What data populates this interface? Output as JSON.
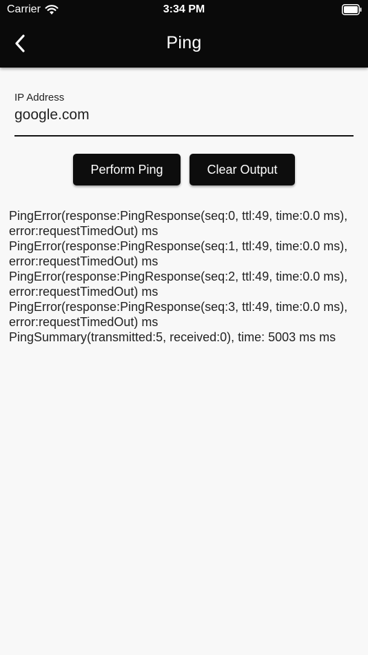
{
  "status_bar": {
    "carrier": "Carrier",
    "time": "3:34 PM",
    "icons": [
      "wifi-icon",
      "battery-icon"
    ]
  },
  "header": {
    "title": "Ping",
    "back_icon": "chevron-left-icon"
  },
  "form": {
    "ip_label": "IP Address",
    "ip_value": "google.com"
  },
  "buttons": {
    "perform_ping": "Perform Ping",
    "clear_output": "Clear Output"
  },
  "output": {
    "lines": [
      "PingError(response:PingResponse(seq:0, ttl:49, time:0.0 ms), error:requestTimedOut) ms",
      "PingError(response:PingResponse(seq:1, ttl:49, time:0.0 ms), error:requestTimedOut) ms",
      "PingError(response:PingResponse(seq:2, ttl:49, time:0.0 ms), error:requestTimedOut) ms",
      "PingError(response:PingResponse(seq:3, ttl:49, time:0.0 ms), error:requestTimedOut) ms",
      "PingSummary(transmitted:5, received:0), time: 5003 ms ms"
    ]
  },
  "colors": {
    "header_background": "#0a0a0a",
    "page_background": "#f8f8f8",
    "button_background": "#0d0d0d",
    "text": "#222222"
  }
}
